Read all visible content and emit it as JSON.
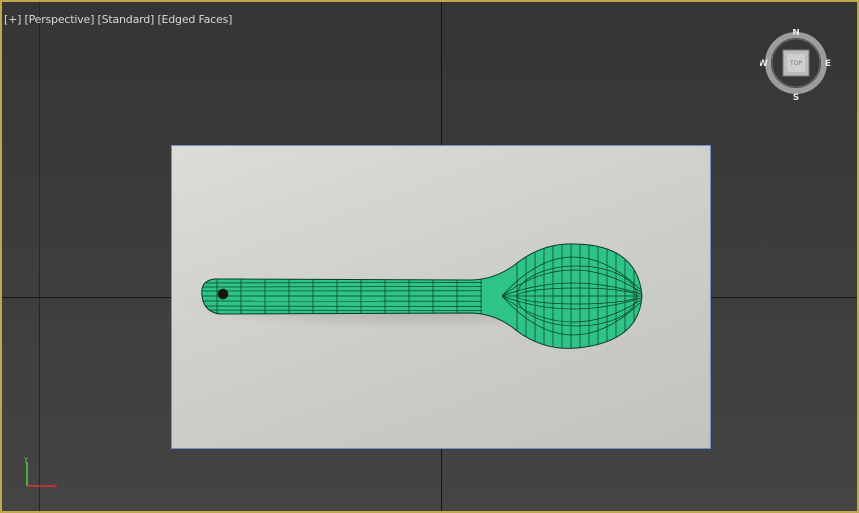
{
  "viewport": {
    "label_plus": "[+]",
    "label_view": "[Perspective]",
    "label_shading": "[Standard]",
    "label_edges": "[Edged Faces]"
  },
  "viewcube": {
    "north": "N",
    "south": "S",
    "east": "E",
    "west": "W",
    "face": "TOP"
  },
  "axis_tripod": {
    "x": "x",
    "y": "y"
  },
  "colors": {
    "active_border": "#c2a64a",
    "mesh_fill": "#2ec489",
    "mesh_wire": "#0a3d22",
    "plate_border": "#6f8fc7"
  }
}
